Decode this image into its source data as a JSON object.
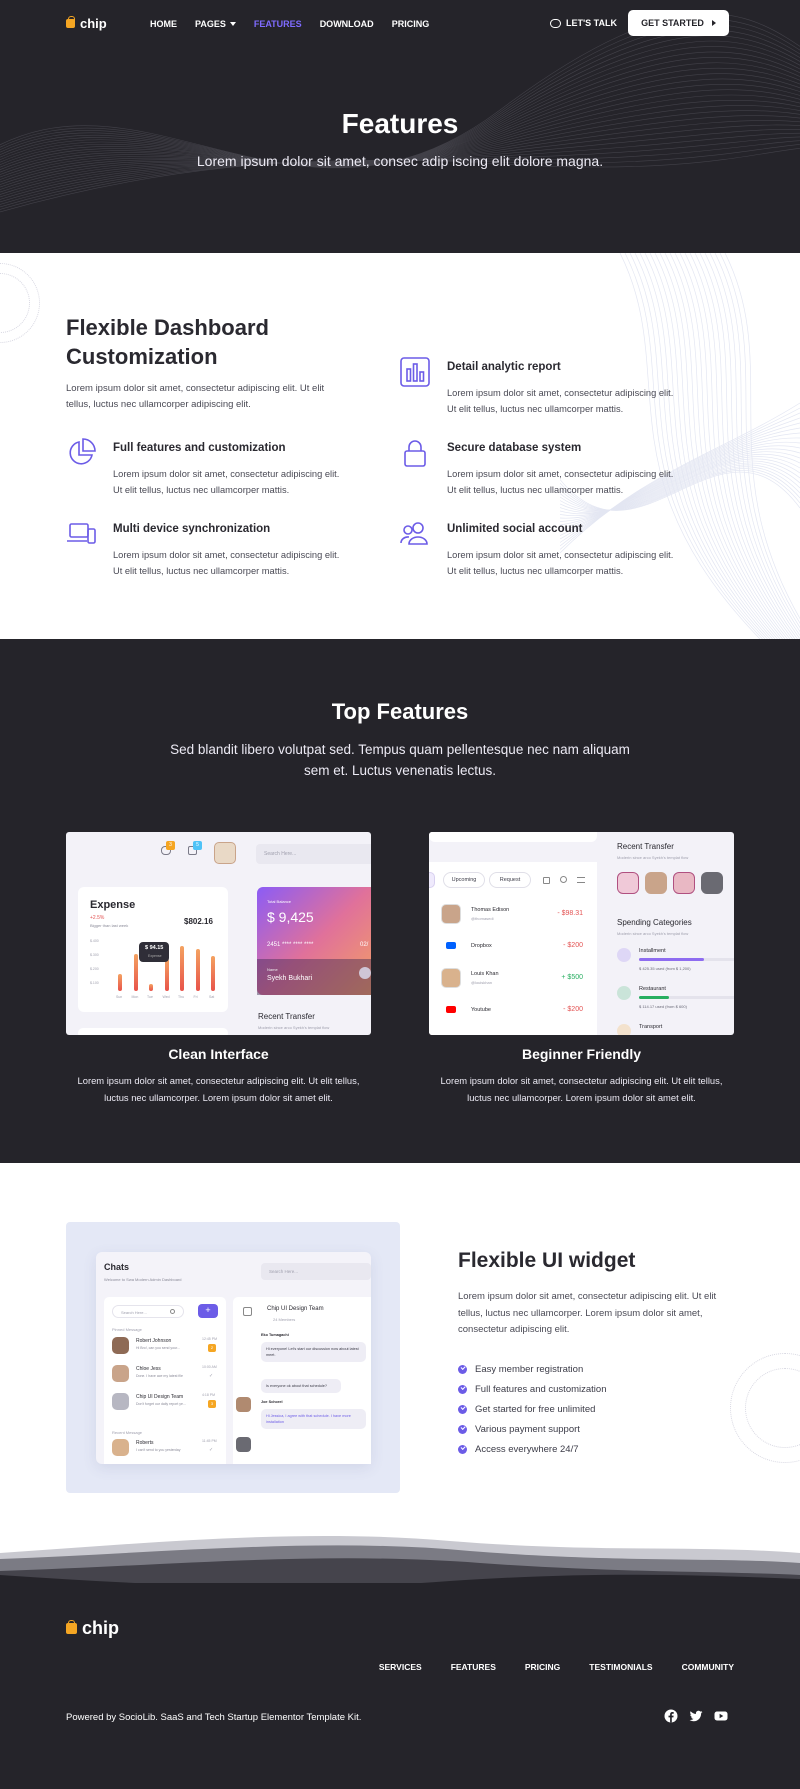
{
  "nav": {
    "logo": "chip",
    "items": [
      {
        "label": "HOME",
        "active": false
      },
      {
        "label": "PAGES",
        "active": false,
        "dropdown": true
      },
      {
        "label": "FEATURES",
        "active": true
      },
      {
        "label": "DOWNLOAD",
        "active": false
      },
      {
        "label": "PRICING",
        "active": false
      }
    ],
    "talk": "LET'S TALK",
    "cta": "GET STARTED"
  },
  "hero": {
    "title": "Features",
    "subtitle": "Lorem ipsum dolor sit amet, consec adip iscing elit dolore magna."
  },
  "flexible": {
    "title": "Flexible Dashboard Customization",
    "description": "Lorem ipsum dolor sit amet, consectetur adipiscing elit. Ut elit tellus, luctus nec ullamcorper adipiscing elit.",
    "features": [
      {
        "icon": "bar-chart-icon",
        "title": "Detail analytic report",
        "text": "Lorem ipsum dolor sit amet, consectetur adipiscing elit. Ut elit tellus, luctus nec ullamcorper mattis."
      },
      {
        "icon": "pie-chart-icon",
        "title": "Full features and customization",
        "text": "Lorem ipsum dolor sit amet, consectetur adipiscing elit. Ut elit tellus, luctus nec ullamcorper mattis."
      },
      {
        "icon": "lock-icon",
        "title": "Secure database system",
        "text": "Lorem ipsum dolor sit amet, consectetur adipiscing elit. Ut elit tellus, luctus nec ullamcorper mattis."
      },
      {
        "icon": "devices-icon",
        "title": "Multi device synchronization",
        "text": "Lorem ipsum dolor sit amet, consectetur adipiscing elit. Ut elit tellus, luctus nec ullamcorper mattis."
      },
      {
        "icon": "users-icon",
        "title": "Unlimited social account",
        "text": "Lorem ipsum dolor sit amet, consectetur adipiscing elit. Ut elit tellus, luctus nec ullamcorper mattis."
      }
    ]
  },
  "top_features": {
    "title": "Top Features",
    "subtitle": "Sed blandit libero volutpat sed. Tempus quam pellentesque nec nam aliquam sem et. Luctus venenatis lectus.",
    "cards": [
      {
        "title": "Clean Interface",
        "text": "Lorem ipsum dolor sit amet, consectetur adipiscing elit. Ut elit tellus, luctus nec ullamcorper. Lorem ipsum dolor sit amet elit."
      },
      {
        "title": "Beginner Friendly",
        "text": "Lorem ipsum dolor sit amet, consectetur adipiscing elit. Ut elit tellus, luctus nec ullamcorper. Lorem ipsum dolor sit amet elit."
      }
    ],
    "shot1": {
      "search": "Search Here...",
      "expense_title": "Expense",
      "expense_change": "+2.5%",
      "expense_note": "Bigger than last week",
      "expense_amount": "$802.16",
      "tooltip_value": "$ 94.15",
      "tooltip_label": "Expense",
      "day_labels": [
        "Sun",
        "Mon",
        "Tue",
        "Wed",
        "Thu",
        "Fri",
        "Sat"
      ],
      "y_labels": [
        "$.400",
        "$.300",
        "$.200",
        "$.100"
      ],
      "bar_values": [
        0.35,
        0.75,
        0.15,
        0.65,
        0.9,
        0.85,
        0.7
      ],
      "badge1": "3",
      "badge2": "5",
      "balance_label": "Total Balance",
      "balance": "$ 9,425",
      "card_number": "2451 **** **** ****",
      "card_expiry": "02/",
      "card_name_label": "Name",
      "card_name": "Syekh Bukhari",
      "recent": "Recent Transfer",
      "recent_note": "Moderin since arco Syekh's templat flow"
    },
    "shot2": {
      "tabs": [
        "Upcoming",
        "Request"
      ],
      "rows": [
        {
          "name": "Thomas Edison",
          "handle": "@thomasedi",
          "amount": "- $98.31",
          "color": "#e35252"
        },
        {
          "name": "Dropbox",
          "handle": "",
          "amount": "- $200",
          "color": "#e35252"
        },
        {
          "name": "Louis Khan",
          "handle": "@louiskhan",
          "amount": "+ $500",
          "color": "#27ae60"
        },
        {
          "name": "Youtube",
          "handle": "",
          "amount": "- $200",
          "color": "#e35252"
        }
      ],
      "recent": "Recent Transfer",
      "recent_note": "Moderin since arco Syekh's templat flow",
      "spending": "Spending Categories",
      "spending_note": "Moderin since arco Syekh's templat flow",
      "categories": [
        {
          "name": "Installment",
          "value": "$ 425.35 used",
          "note": "(from $ 1,200)",
          "color": "#8e6cf0",
          "level": 0.65
        },
        {
          "name": "Restaurant",
          "value": "$ 114.17 used",
          "note": "(from $ 600)",
          "color": "#27ae60",
          "level": 0.3
        },
        {
          "name": "Transport",
          "value": "",
          "note": "",
          "color": "#f5a623",
          "level": 0
        }
      ]
    }
  },
  "widget": {
    "title": "Flexible UI widget",
    "description": "Lorem ipsum dolor sit amet, consectetur adipiscing elit. Ut elit tellus, luctus nec ullamcorper. Lorem ipsum dolor sit amet, consectetur adipiscing elit.",
    "list": [
      "Easy member registration",
      "Full features and customization",
      "Get started for free unlimited",
      "Various payment support",
      "Access everywhere 24/7"
    ],
    "chat": {
      "title": "Chats",
      "subtitle": "Welcome to Swa Modern Admin Dashboard",
      "search": "Search Here...",
      "list_search": "Search Here...",
      "pinned_label": "Pinned Message",
      "recent_label": "Recent Message",
      "contacts": [
        {
          "name": "Robert Johnson",
          "msg": "Hi Bro!, can you send your...",
          "time": "12:45 PM",
          "badge": "2"
        },
        {
          "name": "Chloe Jess",
          "msg": "Done. I have ace my latest file",
          "time": "10:00 AM",
          "badge": ""
        },
        {
          "name": "Chip UI Design Team",
          "msg": "Don't forget our daily report ye...",
          "time": "4:18 PM",
          "badge": "3"
        },
        {
          "name": "Roberts",
          "msg": "I can't send to you yesterday",
          "time": "11:45 PM",
          "badge": ""
        }
      ],
      "thread_title": "Chip UI Design Team",
      "thread_members": "24 Members",
      "messages": [
        {
          "author": "Eko Tumagachi",
          "text": "Hi everyone! Let's start our discussion now about latest meet."
        },
        {
          "author": "",
          "text": "Is everyone ok about that schedule?"
        },
        {
          "author": "Joe Schorel",
          "text": "Hi Jessica, I agree with that schedule. I have more installation"
        }
      ]
    }
  },
  "footer": {
    "logo": "chip",
    "links": [
      "SERVICES",
      "FEATURES",
      "PRICING",
      "TESTIMONIALS",
      "COMMUNITY"
    ],
    "copyright": "Powered by SocioLib. SaaS and Tech Startup Elementor Template Kit.",
    "social": [
      "facebook-icon",
      "twitter-icon",
      "youtube-icon"
    ]
  },
  "colors": {
    "dark": "#25242a",
    "accent": "#6c5ce7",
    "nav_active": "#7f6bff",
    "orange": "#f5a623"
  }
}
